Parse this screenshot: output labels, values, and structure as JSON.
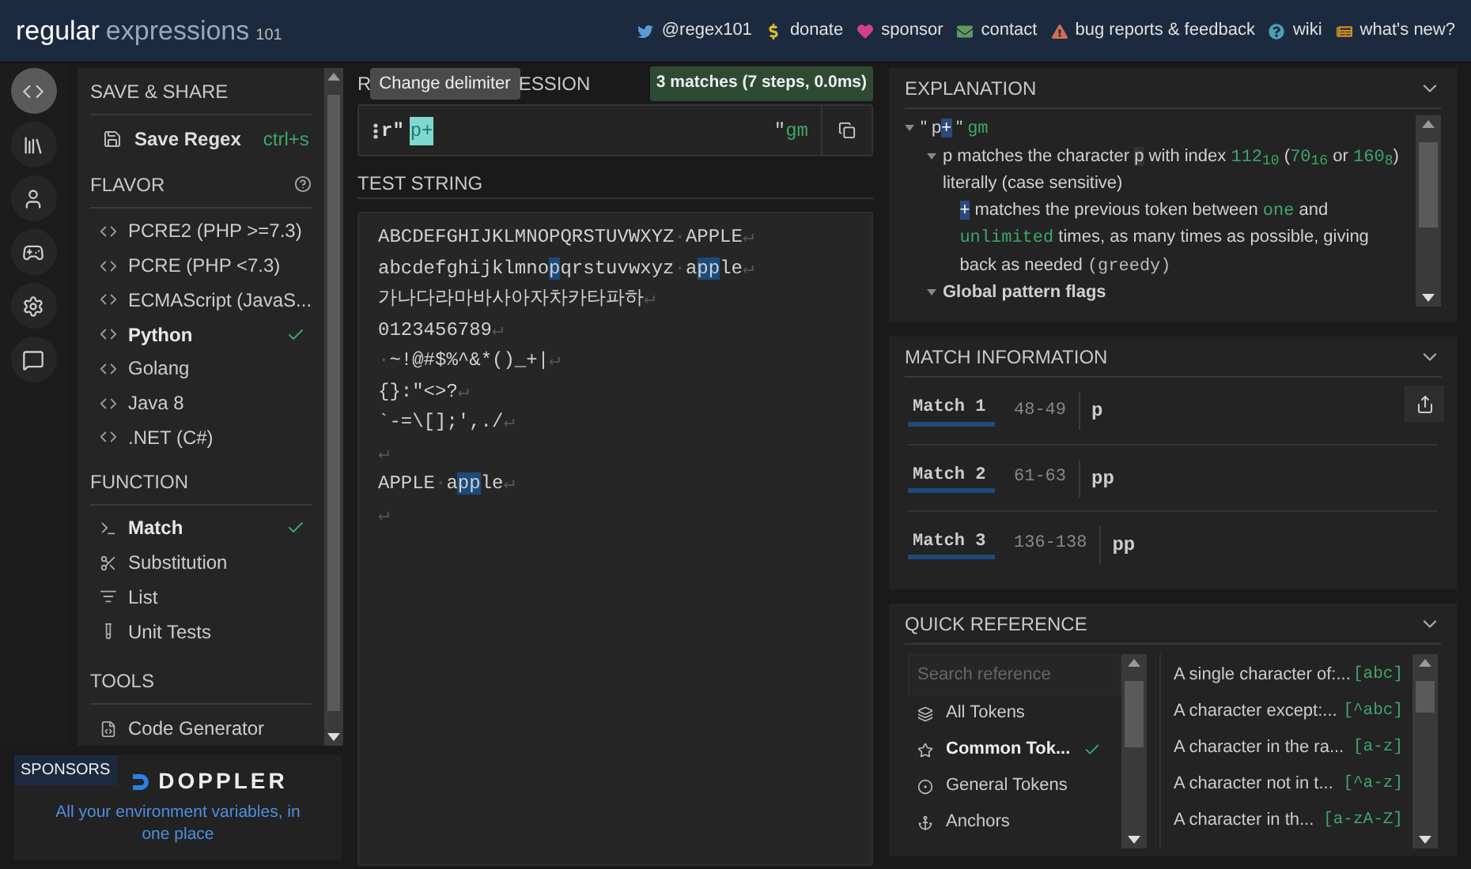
{
  "header": {
    "logo": {
      "word_1": "regular",
      "word_2": "expressions",
      "badge": "101"
    },
    "links": [
      "@regex101",
      "donate",
      "sponsor",
      "contact",
      "bug reports & feedback",
      "wiki",
      "what's new?"
    ]
  },
  "rail": [
    {
      "selected": true
    },
    {
      "selected": false
    },
    {
      "selected": false
    },
    {
      "selected": false
    },
    {
      "selected": false
    },
    {
      "selected": false
    }
  ],
  "sidebar": {
    "save_share": {
      "title": "SAVE & SHARE",
      "label": "Save Regex",
      "shortcut": "ctrl+s"
    },
    "flavor": {
      "title": "FLAVOR",
      "items": [
        {
          "label": "PCRE2 (PHP >=7.3)",
          "selected": false
        },
        {
          "label": "PCRE (PHP <7.3)",
          "selected": false
        },
        {
          "label": "ECMAScript (JavaS...",
          "selected": false
        },
        {
          "label": "Python",
          "selected": true
        },
        {
          "label": "Golang",
          "selected": false
        },
        {
          "label": "Java 8",
          "selected": false
        },
        {
          "label": ".NET (C#)",
          "selected": false
        }
      ]
    },
    "function": {
      "title": "FUNCTION",
      "items": [
        {
          "label": "Match",
          "selected": true
        },
        {
          "label": "Substitution",
          "selected": false
        },
        {
          "label": "List",
          "selected": false
        },
        {
          "label": "Unit Tests",
          "selected": false
        }
      ]
    },
    "tools": {
      "title": "TOOLS",
      "items": [
        "Code Generator"
      ]
    }
  },
  "sponsors": {
    "badge": "SPONSORS",
    "name": "DOPPLER",
    "tagline": "All your environment variables, in one place"
  },
  "regex": {
    "heading_start": "R",
    "tooltip": "Change delimiter",
    "heading_end": "ESSION",
    "status": "3 matches (7 steps, 0.0ms)",
    "prefix": "r\"",
    "pattern": "p+",
    "suffix": "\"",
    "flags": "gm"
  },
  "test_string": {
    "heading": "TEST STRING",
    "lines": [
      [
        {
          "kind": "text",
          "text": "ABCDEFGHIJKLMNOPQRSTUVWXYZ"
        },
        {
          "kind": "space",
          "text": "·"
        },
        {
          "kind": "text",
          "text": "APPLE"
        },
        {
          "kind": "eol",
          "text": "↵"
        }
      ],
      [
        {
          "kind": "text",
          "text": "abcdefghijklmno"
        },
        {
          "kind": "match",
          "text": "p"
        },
        {
          "kind": "text",
          "text": "qrstuvwxyz"
        },
        {
          "kind": "space",
          "text": "·"
        },
        {
          "kind": "text",
          "text": "a"
        },
        {
          "kind": "match",
          "text": "pp"
        },
        {
          "kind": "text",
          "text": "le"
        },
        {
          "kind": "eol",
          "text": "↵"
        }
      ],
      [
        {
          "kind": "text",
          "text": "가나다라마바사아자차카타파하"
        },
        {
          "kind": "eol",
          "text": "↵"
        }
      ],
      [
        {
          "kind": "text",
          "text": "0123456789"
        },
        {
          "kind": "eol",
          "text": "↵"
        }
      ],
      [
        {
          "kind": "space",
          "text": "·"
        },
        {
          "kind": "text",
          "text": "~!@#$%^&*()_+|"
        },
        {
          "kind": "eol",
          "text": "↵"
        }
      ],
      [
        {
          "kind": "text",
          "text": "{}:\"<>?"
        },
        {
          "kind": "eol",
          "text": "↵"
        }
      ],
      [
        {
          "kind": "text",
          "text": "`-=\\[];',./"
        },
        {
          "kind": "eol",
          "text": "↵"
        }
      ],
      [
        {
          "kind": "eol",
          "text": "↵"
        }
      ],
      [
        {
          "kind": "text",
          "text": "APPLE"
        },
        {
          "kind": "space",
          "text": "·"
        },
        {
          "kind": "text",
          "text": "a"
        },
        {
          "kind": "match",
          "text": "pp"
        },
        {
          "kind": "text",
          "text": "le"
        },
        {
          "kind": "eol",
          "text": "↵"
        }
      ],
      [
        {
          "kind": "eol",
          "text": "↵"
        }
      ]
    ]
  },
  "explanation": {
    "title": "EXPLANATION",
    "tree": [
      {
        "expanded": true,
        "segments": [
          {
            "kind": "plain",
            "text": "\" p"
          },
          {
            "kind": "hl",
            "text": "+"
          },
          {
            "kind": "plain",
            "text": " \" "
          },
          {
            "kind": "green",
            "text": "gm"
          }
        ],
        "children": [
          {
            "expanded": true,
            "segments": [
              {
                "kind": "plain",
                "text": "p matches the character "
              },
              {
                "kind": "boxed",
                "text": "p"
              },
              {
                "kind": "plain",
                "text": " with index "
              },
              {
                "kind": "green",
                "text": "112"
              },
              {
                "kind": "sub",
                "text": "10"
              },
              {
                "kind": "plain",
                "text": " ("
              },
              {
                "kind": "green",
                "text": "70"
              },
              {
                "kind": "sub",
                "text": "16"
              },
              {
                "kind": "plain",
                "text": " or "
              },
              {
                "kind": "green",
                "text": "160"
              },
              {
                "kind": "sub",
                "text": "8"
              },
              {
                "kind": "plain",
                "text": ") literally (case sensitive)"
              }
            ],
            "children": [
              {
                "segments": [
                  {
                    "kind": "hl",
                    "text": "+"
                  },
                  {
                    "kind": "plain",
                    "text": " matches the previous token between "
                  },
                  {
                    "kind": "green",
                    "text": "one"
                  },
                  {
                    "kind": "plain",
                    "text": " and "
                  },
                  {
                    "kind": "green",
                    "text": "unlimited"
                  },
                  {
                    "kind": "plain",
                    "text": " times, as many times as possible, giving back as needed "
                  },
                  {
                    "kind": "mono",
                    "text": "(greedy)"
                  }
                ]
              }
            ]
          },
          {
            "expanded": true,
            "segments": [
              {
                "kind": "bold",
                "text": "Global pattern flags"
              }
            ]
          }
        ]
      }
    ]
  },
  "match_info": {
    "title": "MATCH INFORMATION",
    "matches": [
      {
        "label": "Match 1",
        "range": "48-49",
        "value": "p"
      },
      {
        "label": "Match 2",
        "range": "61-63",
        "value": "pp"
      },
      {
        "label": "Match 3",
        "range": "136-138",
        "value": "pp"
      }
    ]
  },
  "quick_reference": {
    "title": "QUICK REFERENCE",
    "search_placeholder": "Search reference",
    "categories": [
      {
        "label": "All Tokens",
        "selected": false
      },
      {
        "label": "Common Tok...",
        "selected": true
      },
      {
        "label": "General Tokens",
        "selected": false
      },
      {
        "label": "Anchors",
        "selected": false
      }
    ],
    "tokens": [
      {
        "description": "A single character of:...",
        "token": "[abc]"
      },
      {
        "description": "A character except:...",
        "token": "[^abc]"
      },
      {
        "description": "A character in the ra...",
        "token": "[a-z]"
      },
      {
        "description": "A character not in t...",
        "token": "[^a-z]"
      },
      {
        "description": "A character in th...",
        "token": "[a-zA-Z]"
      }
    ]
  }
}
